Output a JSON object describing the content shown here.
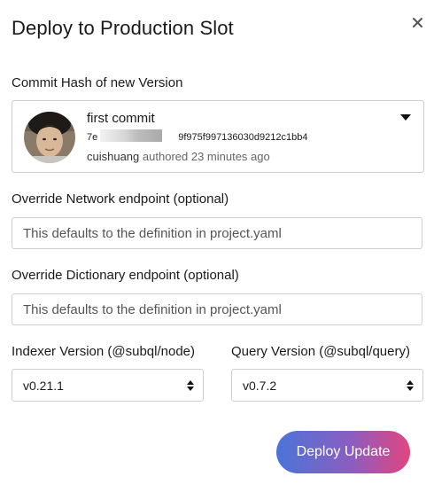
{
  "dialog": {
    "title": "Deploy to Production Slot",
    "close_label": "×"
  },
  "commit": {
    "label": "Commit Hash of new Version",
    "message": "first commit",
    "hash_visible_prefix": "7e",
    "hash_visible_suffix": "9f975f997136030d9212c1bb4",
    "author": "cuishuang",
    "authored_text": "authored 23 minutes ago"
  },
  "network": {
    "label": "Override Network endpoint (optional)",
    "placeholder": "This defaults to the definition in project.yaml"
  },
  "dictionary": {
    "label": "Override Dictionary endpoint (optional)",
    "placeholder": "This defaults to the definition in project.yaml"
  },
  "indexer": {
    "label": "Indexer Version (@subql/node)",
    "value": "v0.21.1"
  },
  "query": {
    "label": "Query Version (@subql/query)",
    "value": "v0.7.2"
  },
  "actions": {
    "deploy_label": "Deploy Update"
  },
  "colors": {
    "button_gradient_start": "#4b74d9",
    "button_gradient_mid": "#8a5ec0",
    "button_gradient_end": "#e2457f",
    "border": "#cfcfcf"
  }
}
